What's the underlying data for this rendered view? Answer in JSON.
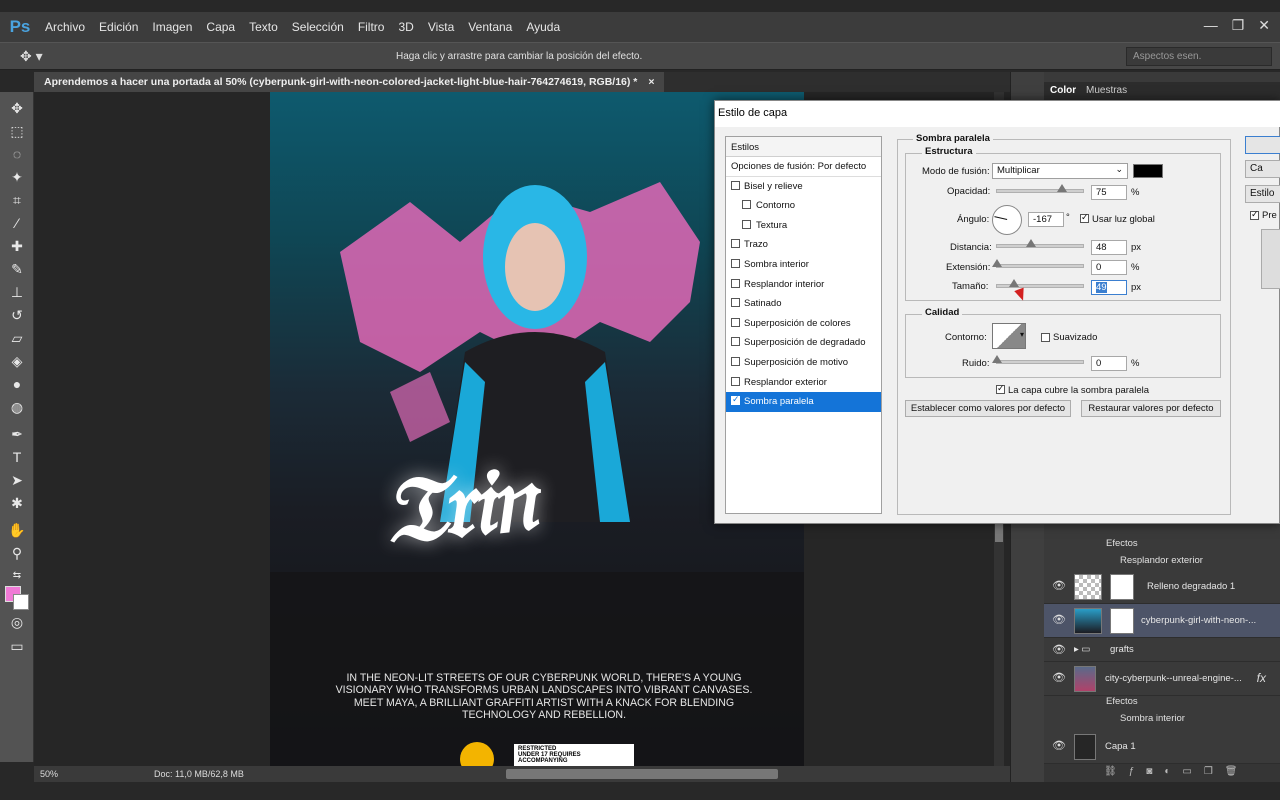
{
  "app": {
    "logo": "Ps",
    "menu": [
      "Archivo",
      "Edición",
      "Imagen",
      "Capa",
      "Texto",
      "Selección",
      "Filtro",
      "3D",
      "Vista",
      "Ventana",
      "Ayuda"
    ],
    "window_controls": [
      "—",
      "❐",
      "✕"
    ]
  },
  "options_bar": {
    "hint": "Haga clic y arrastre para cambiar la posición del efecto.",
    "workspace": "Aspectos esen."
  },
  "document": {
    "tab_title": "Aprendemos a hacer una portada al 50% (cyberpunk-girl-with-neon-colored-jacket-light-blue-hair-764274619, RGB/16) *",
    "tab_close": "×",
    "poster_text": "IN THE NEON-LIT STREETS OF OUR CYBERPUNK WORLD, THERE'S A YOUNG VISIONARY WHO TRANSFORMS URBAN LANDSCAPES INTO VIBRANT CANVASES. MEET MAYA, A BRILLIANT GRAFFITI ARTIST WITH A KNACK FOR BLENDING  TECHNOLOGY AND REBELLION.",
    "rating_title": "RESTRICTED",
    "rating_sub": "UNDER 17 REQUIRES ACCOMPANYING"
  },
  "status": {
    "zoom": "50%",
    "doc_size": "Doc: 11,0 MB/62,8 MB"
  },
  "colors": {
    "foreground": "#f07ad6",
    "background": "#ffffff",
    "selection_blue": "#1474d8"
  },
  "panels": {
    "tabs": [
      "Color",
      "Muestras"
    ],
    "layers": {
      "efectos_1": "Efectos",
      "resplandor_exterior": "Resplandor exterior",
      "relleno": "Relleno degradado 1",
      "girl": "cyberpunk-girl-with-neon-...",
      "grafts": "grafts",
      "city": "city-cyberpunk--unreal-engine-...",
      "efectos_2": "Efectos",
      "sombra_interior": "Sombra interior",
      "capa1": "Capa 1",
      "fx": "fx"
    }
  },
  "dialog": {
    "title": "Estilo de capa",
    "styles_header": "Estilos",
    "blend_options": "Opciones de fusión: Por defecto",
    "styles": [
      {
        "label": "Bisel y relieve",
        "checked": false,
        "indent": false
      },
      {
        "label": "Contorno",
        "checked": false,
        "indent": true
      },
      {
        "label": "Textura",
        "checked": false,
        "indent": true
      },
      {
        "label": "Trazo",
        "checked": false,
        "indent": false
      },
      {
        "label": "Sombra interior",
        "checked": false,
        "indent": false
      },
      {
        "label": "Resplandor interior",
        "checked": false,
        "indent": false
      },
      {
        "label": "Satinado",
        "checked": false,
        "indent": false
      },
      {
        "label": "Superposición de colores",
        "checked": false,
        "indent": false
      },
      {
        "label": "Superposición de degradado",
        "checked": false,
        "indent": false
      },
      {
        "label": "Superposición de motivo",
        "checked": false,
        "indent": false
      },
      {
        "label": "Resplandor exterior",
        "checked": false,
        "indent": false
      },
      {
        "label": "Sombra paralela",
        "checked": true,
        "indent": false,
        "selected": true
      }
    ],
    "section_title": "Sombra paralela",
    "structure_label": "Estructura",
    "blend_mode_label": "Modo de fusión:",
    "blend_mode_value": "Multiplicar",
    "opacity_label": "Opacidad:",
    "opacity_value": "75",
    "opacity_unit": "%",
    "angle_label": "Ángulo:",
    "angle_value": "-167",
    "angle_unit": "°",
    "global_light_label": "Usar luz global",
    "distance_label": "Distancia:",
    "distance_value": "48",
    "distance_unit": "px",
    "spread_label": "Extensión:",
    "spread_value": "0",
    "spread_unit": "%",
    "size_label": "Tamaño:",
    "size_value": "49",
    "size_unit": "px",
    "quality_label": "Calidad",
    "contour_label": "Contorno:",
    "antialias_label": "Suavizado",
    "noise_label": "Ruido:",
    "noise_value": "0",
    "noise_unit": "%",
    "knockout_label": "La capa cubre la sombra paralela",
    "set_default": "Establecer como valores por defecto",
    "reset_default": "Restaurar valores por defecto",
    "side_ok": "",
    "side_cancel": "Ca",
    "side_style": "Estilo",
    "side_preview": "Pre",
    "sliders": {
      "opacity": 0.75,
      "distance": 0.4,
      "spread": 0.0,
      "size": 0.2,
      "noise": 0.0
    }
  }
}
